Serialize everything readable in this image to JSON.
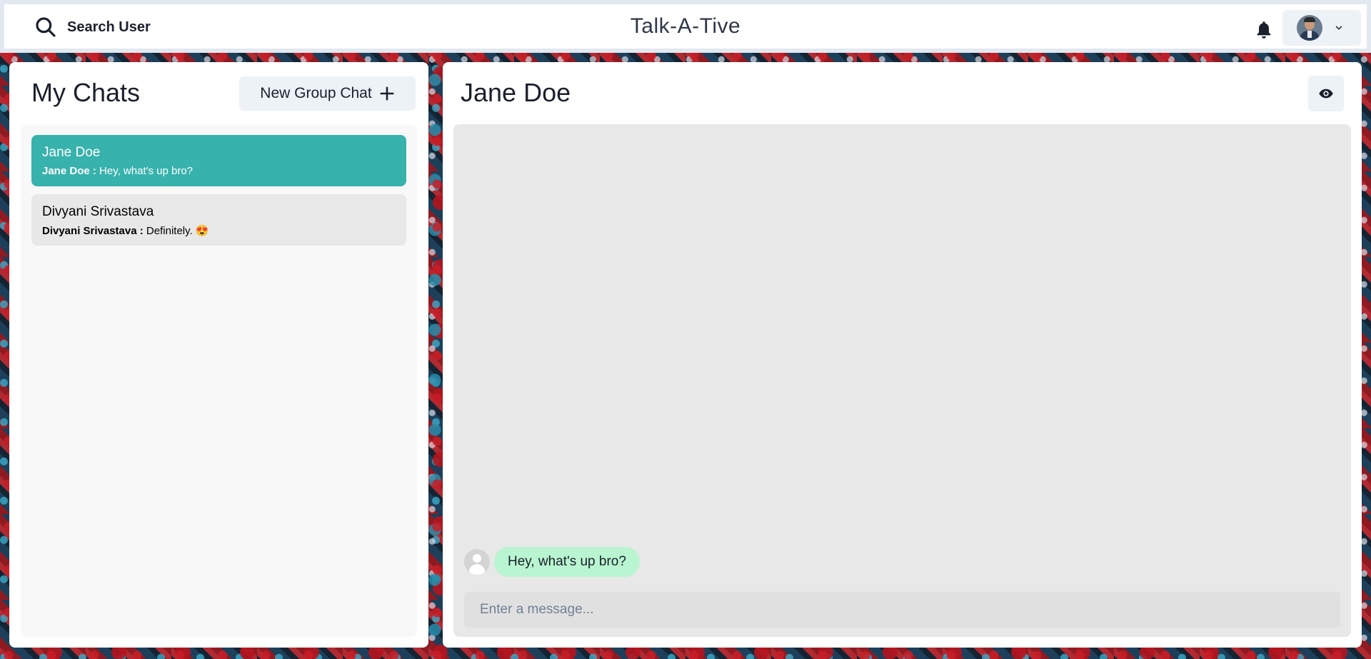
{
  "header": {
    "search_label": "Search User",
    "app_title": "Talk-A-Tive"
  },
  "chats_panel": {
    "title": "My Chats",
    "new_group_label": "New Group Chat",
    "chats": [
      {
        "name": "Jane Doe",
        "last_sender": "Jane Doe :",
        "last_message": "Hey, what's up bro?",
        "active": true
      },
      {
        "name": "Divyani Srivastava",
        "last_sender": "Divyani Srivastava :",
        "last_message": "Definitely. 😍",
        "active": false
      }
    ]
  },
  "chatbox": {
    "title": "Jane Doe",
    "messages": [
      {
        "text": "Hey, what's up bro?"
      }
    ],
    "input_placeholder": "Enter a message..."
  },
  "colors": {
    "accent": "#38b2ac",
    "bubble": "#b9f5d0"
  }
}
